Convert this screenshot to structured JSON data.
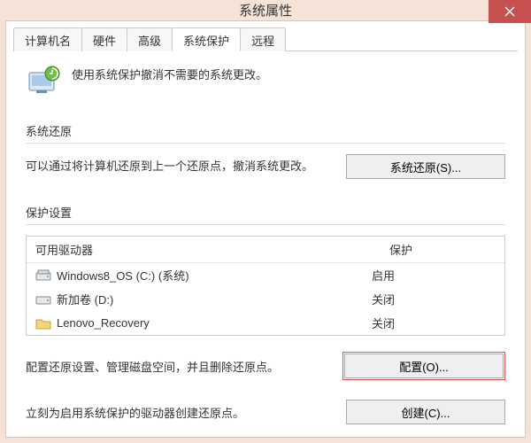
{
  "titlebar": {
    "title": "系统属性"
  },
  "tabs": {
    "items": [
      {
        "label": "计算机名"
      },
      {
        "label": "硬件"
      },
      {
        "label": "高级"
      },
      {
        "label": "系统保护"
      },
      {
        "label": "远程"
      }
    ]
  },
  "intro": {
    "text": "使用系统保护撤消不需要的系统更改。"
  },
  "section_restore": {
    "heading": "系统还原",
    "text": "可以通过将计算机还原到上一个还原点，撤消系统更改。",
    "button": "系统还原(S)..."
  },
  "section_protect": {
    "heading": "保护设置",
    "header_drive": "可用驱动器",
    "header_prot": "保护",
    "drives": [
      {
        "name": "Windows8_OS (C:) (系统)",
        "protection": "启用",
        "icon": "drive"
      },
      {
        "name": "新加卷 (D:)",
        "protection": "关闭",
        "icon": "drive"
      },
      {
        "name": "Lenovo_Recovery",
        "protection": "关闭",
        "icon": "folder"
      }
    ]
  },
  "section_config": {
    "text": "配置还原设置、管理磁盘空间，并且删除还原点。",
    "button": "配置(O)..."
  },
  "section_create": {
    "text": "立刻为启用系统保护的驱动器创建还原点。",
    "button": "创建(C)..."
  }
}
